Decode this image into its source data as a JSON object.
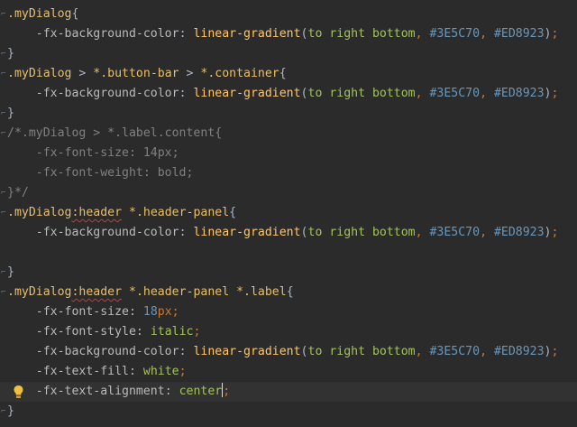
{
  "editor": {
    "colors": {
      "background": "#2b2b2b",
      "selector": "#e8bf6a",
      "property": "#bababa",
      "function": "#ffc66d",
      "keyword": "#a5c25c",
      "hex": "#6897bb",
      "punctuation": "#cc7832",
      "comment": "#808080",
      "current_line": "#323232",
      "intention_bulb": "#f0c040"
    },
    "current_line_index": 19,
    "lines": [
      {
        "fold": true,
        "tokens": [
          {
            "t": "sel",
            "v": ".myDialog"
          },
          {
            "t": "plain",
            "v": "{"
          }
        ]
      },
      {
        "fold": false,
        "tokens": [
          {
            "t": "plain",
            "v": "    "
          },
          {
            "t": "prop",
            "v": "-fx-background-color"
          },
          {
            "t": "plain",
            "v": ": "
          },
          {
            "t": "func",
            "v": "linear-gradient"
          },
          {
            "t": "plain",
            "v": "("
          },
          {
            "t": "kw",
            "v": "to right bottom"
          },
          {
            "t": "punct",
            "v": ", "
          },
          {
            "t": "hex",
            "v": "#3E5C70"
          },
          {
            "t": "punct",
            "v": ", "
          },
          {
            "t": "hex",
            "v": "#ED8923"
          },
          {
            "t": "plain",
            "v": ")"
          },
          {
            "t": "punct",
            "v": ";"
          }
        ]
      },
      {
        "fold": true,
        "tokens": [
          {
            "t": "plain",
            "v": "}"
          }
        ]
      },
      {
        "fold": true,
        "tokens": [
          {
            "t": "sel",
            "v": ".myDialog"
          },
          {
            "t": "plain",
            "v": " > "
          },
          {
            "t": "sel",
            "v": "*.button-bar"
          },
          {
            "t": "plain",
            "v": " > "
          },
          {
            "t": "sel",
            "v": "*.container"
          },
          {
            "t": "plain",
            "v": "{"
          }
        ]
      },
      {
        "fold": false,
        "tokens": [
          {
            "t": "plain",
            "v": "    "
          },
          {
            "t": "prop",
            "v": "-fx-background-color"
          },
          {
            "t": "plain",
            "v": ": "
          },
          {
            "t": "func",
            "v": "linear-gradient"
          },
          {
            "t": "plain",
            "v": "("
          },
          {
            "t": "kw",
            "v": "to right bottom"
          },
          {
            "t": "punct",
            "v": ", "
          },
          {
            "t": "hex",
            "v": "#3E5C70"
          },
          {
            "t": "punct",
            "v": ", "
          },
          {
            "t": "hex",
            "v": "#ED8923"
          },
          {
            "t": "plain",
            "v": ")"
          },
          {
            "t": "punct",
            "v": ";"
          }
        ]
      },
      {
        "fold": true,
        "tokens": [
          {
            "t": "plain",
            "v": "}"
          }
        ]
      },
      {
        "fold": true,
        "tokens": [
          {
            "t": "comment",
            "v": "/*.myDialog > *.label.content{"
          }
        ]
      },
      {
        "fold": false,
        "tokens": [
          {
            "t": "comment",
            "v": "    -fx-font-size: 14px;"
          }
        ]
      },
      {
        "fold": false,
        "tokens": [
          {
            "t": "comment",
            "v": "    -fx-font-weight: bold;"
          }
        ]
      },
      {
        "fold": true,
        "tokens": [
          {
            "t": "comment",
            "v": "}*/"
          }
        ]
      },
      {
        "fold": true,
        "tokens": [
          {
            "t": "sel",
            "v": ".myDialog"
          },
          {
            "t": "pseudo",
            "v": ":header"
          },
          {
            "t": "plain",
            "v": " "
          },
          {
            "t": "sel",
            "v": "*.header-panel"
          },
          {
            "t": "plain",
            "v": "{"
          }
        ]
      },
      {
        "fold": false,
        "tokens": [
          {
            "t": "plain",
            "v": "    "
          },
          {
            "t": "prop",
            "v": "-fx-background-color"
          },
          {
            "t": "plain",
            "v": ": "
          },
          {
            "t": "func",
            "v": "linear-gradient"
          },
          {
            "t": "plain",
            "v": "("
          },
          {
            "t": "kw",
            "v": "to right bottom"
          },
          {
            "t": "punct",
            "v": ", "
          },
          {
            "t": "hex",
            "v": "#3E5C70"
          },
          {
            "t": "punct",
            "v": ", "
          },
          {
            "t": "hex",
            "v": "#ED8923"
          },
          {
            "t": "plain",
            "v": ")"
          },
          {
            "t": "punct",
            "v": ";"
          }
        ]
      },
      {
        "fold": false,
        "tokens": []
      },
      {
        "fold": true,
        "tokens": [
          {
            "t": "plain",
            "v": "}"
          }
        ]
      },
      {
        "fold": true,
        "tokens": [
          {
            "t": "sel",
            "v": ".myDialog"
          },
          {
            "t": "pseudo",
            "v": ":header"
          },
          {
            "t": "plain",
            "v": " "
          },
          {
            "t": "sel",
            "v": "*.header-panel"
          },
          {
            "t": "plain",
            "v": " "
          },
          {
            "t": "sel",
            "v": "*.label"
          },
          {
            "t": "plain",
            "v": "{"
          }
        ]
      },
      {
        "fold": false,
        "tokens": [
          {
            "t": "plain",
            "v": "    "
          },
          {
            "t": "prop",
            "v": "-fx-font-size"
          },
          {
            "t": "plain",
            "v": ": "
          },
          {
            "t": "num",
            "v": "18"
          },
          {
            "t": "punct",
            "v": "px;"
          }
        ]
      },
      {
        "fold": false,
        "tokens": [
          {
            "t": "plain",
            "v": "    "
          },
          {
            "t": "prop",
            "v": "-fx-font-style"
          },
          {
            "t": "plain",
            "v": ": "
          },
          {
            "t": "kw",
            "v": "italic"
          },
          {
            "t": "punct",
            "v": ";"
          }
        ]
      },
      {
        "fold": false,
        "tokens": [
          {
            "t": "plain",
            "v": "    "
          },
          {
            "t": "prop",
            "v": "-fx-background-color"
          },
          {
            "t": "plain",
            "v": ": "
          },
          {
            "t": "func",
            "v": "linear-gradient"
          },
          {
            "t": "plain",
            "v": "("
          },
          {
            "t": "kw",
            "v": "to right bottom"
          },
          {
            "t": "punct",
            "v": ", "
          },
          {
            "t": "hex",
            "v": "#3E5C70"
          },
          {
            "t": "punct",
            "v": ", "
          },
          {
            "t": "hex",
            "v": "#ED8923"
          },
          {
            "t": "plain",
            "v": ")"
          },
          {
            "t": "punct",
            "v": ";"
          }
        ]
      },
      {
        "fold": false,
        "tokens": [
          {
            "t": "plain",
            "v": "    "
          },
          {
            "t": "prop",
            "v": "-fx-text-fill"
          },
          {
            "t": "plain",
            "v": ": "
          },
          {
            "t": "kw",
            "v": "white"
          },
          {
            "t": "punct",
            "v": ";"
          }
        ]
      },
      {
        "fold": false,
        "tokens": [
          {
            "t": "plain",
            "v": "    "
          },
          {
            "t": "prop",
            "v": "-fx-text-alignment"
          },
          {
            "t": "plain",
            "v": ": "
          },
          {
            "t": "kw",
            "v": "center"
          },
          {
            "t": "caret",
            "v": ""
          },
          {
            "t": "punct",
            "v": ";"
          }
        ]
      },
      {
        "fold": true,
        "tokens": [
          {
            "t": "plain",
            "v": "}"
          }
        ]
      }
    ]
  }
}
